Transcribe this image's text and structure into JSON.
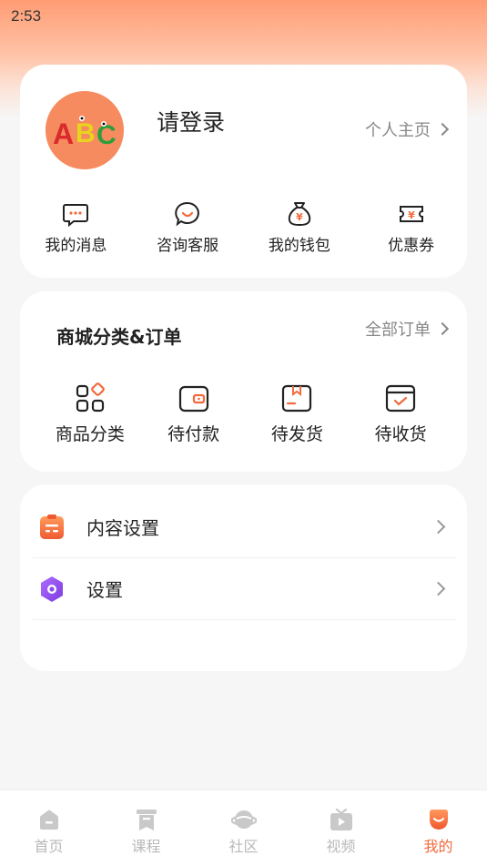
{
  "status_bar": {
    "time": "2:53"
  },
  "profile": {
    "title": "请登录",
    "homepage_link": "个人主页",
    "avatar_text": "ABC",
    "quick_actions": [
      {
        "label": "我的消息",
        "icon": "message-icon"
      },
      {
        "label": "咨询客服",
        "icon": "customer-service-icon"
      },
      {
        "label": "我的钱包",
        "icon": "wallet-bag-icon"
      },
      {
        "label": "优惠券",
        "icon": "coupon-icon"
      }
    ]
  },
  "mall": {
    "title": "商城分类&订单",
    "all_orders": "全部订单",
    "items": [
      {
        "label": "商品分类",
        "icon": "category-icon"
      },
      {
        "label": "待付款",
        "icon": "wallet-icon"
      },
      {
        "label": "待发货",
        "icon": "package-icon"
      },
      {
        "label": "待收货",
        "icon": "delivery-box-icon"
      }
    ]
  },
  "settings": {
    "items": [
      {
        "label": "内容设置",
        "icon": "content-settings-icon"
      },
      {
        "label": "设置",
        "icon": "settings-icon"
      }
    ]
  },
  "tabbar": {
    "tabs": [
      {
        "label": "首页",
        "icon": "home-icon",
        "active": false
      },
      {
        "label": "课程",
        "icon": "course-icon",
        "active": false
      },
      {
        "label": "社区",
        "icon": "community-icon",
        "active": false
      },
      {
        "label": "视频",
        "icon": "video-icon",
        "active": false
      },
      {
        "label": "我的",
        "icon": "profile-icon",
        "active": true
      }
    ]
  },
  "colors": {
    "accent": "#f26a3c",
    "icon_orange": "#f26a3c",
    "purple": "#8a4de8"
  }
}
